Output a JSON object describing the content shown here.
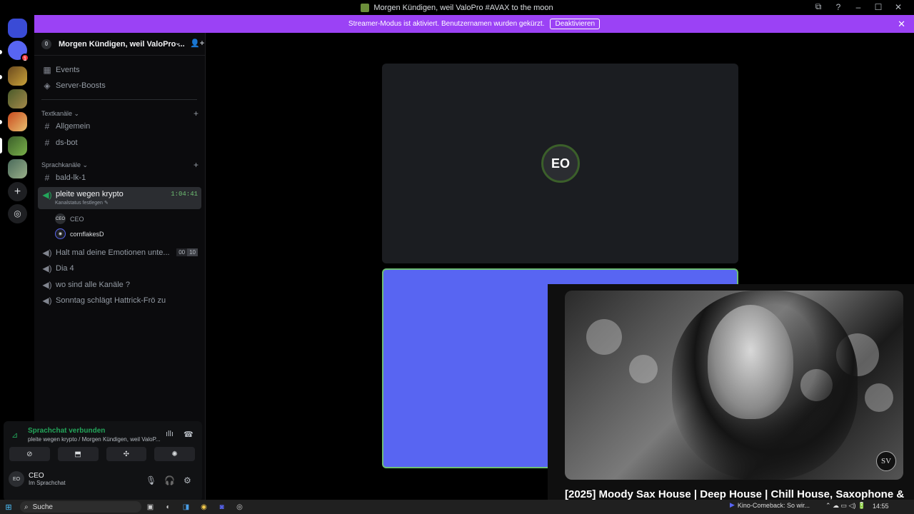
{
  "window": {
    "title": "Morgen Kündigen, weil ValoPro #AVAX to the moon",
    "controls": [
      "⧉",
      "?",
      "–",
      "☐",
      "✕"
    ]
  },
  "banner": {
    "text": "Streamer-Modus ist aktiviert. Benutzernamen wurden gekürzt.",
    "button": "Deaktivieren",
    "close": "✕"
  },
  "guilds": {
    "mention_badge": "1",
    "add": "+",
    "explore": "◎"
  },
  "server": {
    "name": "Morgen Kündigen, weil ValoPro ...",
    "boost_glyph": "0",
    "chevron": "⌄",
    "invite": "👤+"
  },
  "nav": {
    "events": "Events",
    "boosts": "Server-Boosts"
  },
  "categories": {
    "text": "Textkanäle ⌄",
    "voice": "Sprachkanäle ⌄",
    "plus": "+"
  },
  "text_channels": [
    "Allgemein",
    "ds-bot"
  ],
  "voice_channels": {
    "bald": "bald-lk-1",
    "active": {
      "name": "pleite wegen krypto",
      "timer": "1:04:41",
      "status": "Kanalstatus festlegen ✎"
    },
    "users": [
      {
        "avatar": "CEO",
        "name": "CEO"
      },
      {
        "avatar": "◉",
        "name": "cornflakesD"
      }
    ],
    "halt": {
      "name": "Halt mal deine Emotionen unte...",
      "count_a": "00",
      "count_b": "10"
    },
    "others": [
      "Dia 4",
      "wo sind alle Kanäle ?",
      "Sonntag schlägt Hattrick-Frö zu"
    ]
  },
  "voice_panel": {
    "connected": "Sprachchat verbunden",
    "location": "pleite wegen krypto / Morgen Kündigen, weil ValoP...",
    "buttons": [
      "⊘",
      "⬒",
      "✣",
      "✺"
    ],
    "wave": "ıllı",
    "hangup": "☎"
  },
  "user": {
    "avatar": "EO",
    "name": "CEO",
    "status": "Im Sprachchat",
    "mic": "🎙",
    "headset": "🎧",
    "settings": "⚙"
  },
  "stage": {
    "speaker_avatar": "EO"
  },
  "pip": {
    "logo": "SV",
    "video_title": "[2025] Moody Sax House | Deep House | Chill House, Saxophone &"
  },
  "taskbar": {
    "start": "⊞",
    "search": "Suche",
    "news": "Kino-Comeback: So wir...",
    "tray": "⌃ ☁ ▭ ◁) 🔋",
    "time": "14:55"
  },
  "colors": {
    "accent": "#9b42f5",
    "blurple": "#5865f2",
    "online": "#23a55a"
  }
}
